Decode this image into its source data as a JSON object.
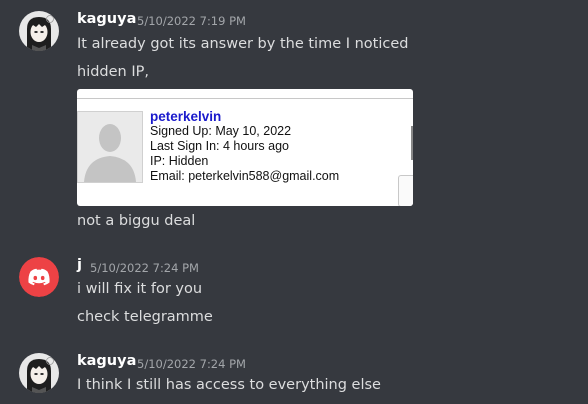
{
  "messages": [
    {
      "username": "kaguya",
      "timestamp": "5/10/2022 7:19 PM",
      "lines": [
        "It already got its answer by the time I noticed",
        "hidden IP,"
      ],
      "after_embed": "not a biggu deal"
    },
    {
      "username": "j",
      "timestamp": "5/10/2022 7:24 PM",
      "lines": [
        "i will fix it for you",
        "check telegramme"
      ]
    },
    {
      "username": "kaguya",
      "timestamp": "5/10/2022 7:24 PM",
      "lines": [
        "I think I still has access to everything else"
      ]
    }
  ],
  "embed": {
    "username": "peterkelvin",
    "signed_up": "Signed Up: May 10, 2022",
    "last_sign_in": "Last Sign In: 4 hours ago",
    "ip": "IP: Hidden",
    "email": "Email: peterkelvin588@gmail.com"
  },
  "colors": {
    "background": "#36393f",
    "username": "#ffffff",
    "message_text": "#dcddde",
    "timestamp": "#a3a6aa",
    "discord_blurple": "#ed4245",
    "embed_link": "#1a1acc"
  },
  "icons": {
    "kaguya_avatar": "anime-girl-avatar-icon",
    "j_avatar": "discord-logo-icon",
    "embed_avatar": "default-profile-silhouette-icon"
  }
}
